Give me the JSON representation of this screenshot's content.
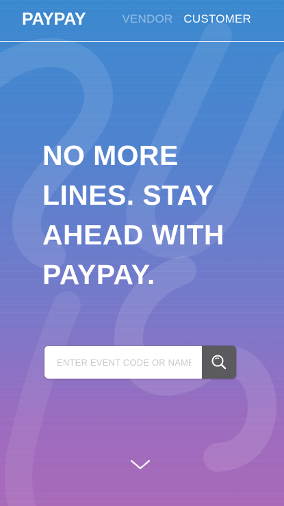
{
  "header": {
    "logo": "PAYPAY",
    "nav": {
      "vendor": "VENDOR",
      "customer": "CUSTOMER"
    }
  },
  "hero": {
    "headline": "NO MORE LINES. STAY AHEAD WITH PAYPAY."
  },
  "search": {
    "placeholder": "ENTER EVENT CODE OR NAME",
    "icon": "search-icon"
  },
  "scroll": {
    "icon": "chevron-down-icon"
  },
  "colors": {
    "gradient_top": "#3a89cf",
    "gradient_bottom": "#a96ab9",
    "search_button": "#5b5b5f",
    "text": "#ffffff"
  }
}
